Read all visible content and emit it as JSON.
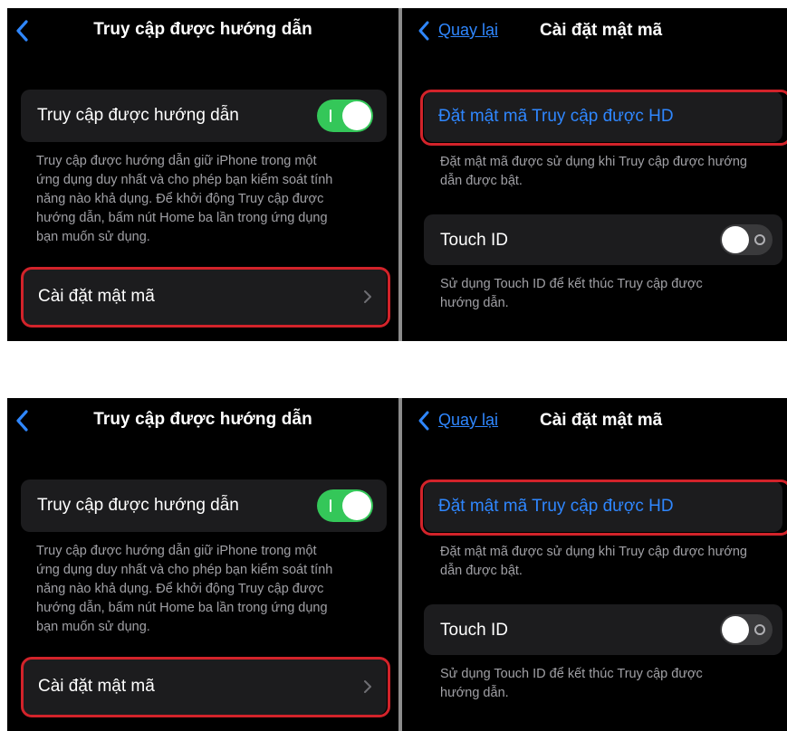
{
  "left_screen": {
    "title": "Truy cập được hướng dẫn",
    "guided_access_toggle": {
      "label": "Truy cập được hướng dẫn",
      "state": "on"
    },
    "description_lines": [
      "Truy cập được hướng dẫn giữ iPhone trong một",
      "ứng dụng duy nhất và cho phép bạn kiểm soát tính",
      "năng nào khả dụng. Để khởi động Truy cập được",
      "hướng dẫn, bấm nút Home ba lần trong ứng dụng",
      "bạn muốn sử dụng."
    ],
    "passcode_settings": {
      "label": "Cài đặt mật mã"
    }
  },
  "right_screen": {
    "back_label": "Quay lại",
    "title": "Cài đặt mật mã",
    "set_passcode": {
      "label": "Đặt mật mã Truy cập được HD"
    },
    "passcode_footer_lines": [
      "Đặt mật mã được sử dụng khi Truy cập được hướng",
      "dẫn được bật."
    ],
    "touch_id": {
      "label": "Touch ID",
      "state": "off"
    },
    "touch_id_footer_lines": [
      "Sử dụng Touch ID để kết thúc Truy cập được",
      "hướng dẫn."
    ]
  },
  "colors": {
    "background": "#000000",
    "cell": "#1c1c1e",
    "accent_blue": "#2f87ff",
    "toggle_on_green": "#34c759",
    "highlight_red": "#d2232a",
    "secondary_text": "#a0a0a5"
  }
}
